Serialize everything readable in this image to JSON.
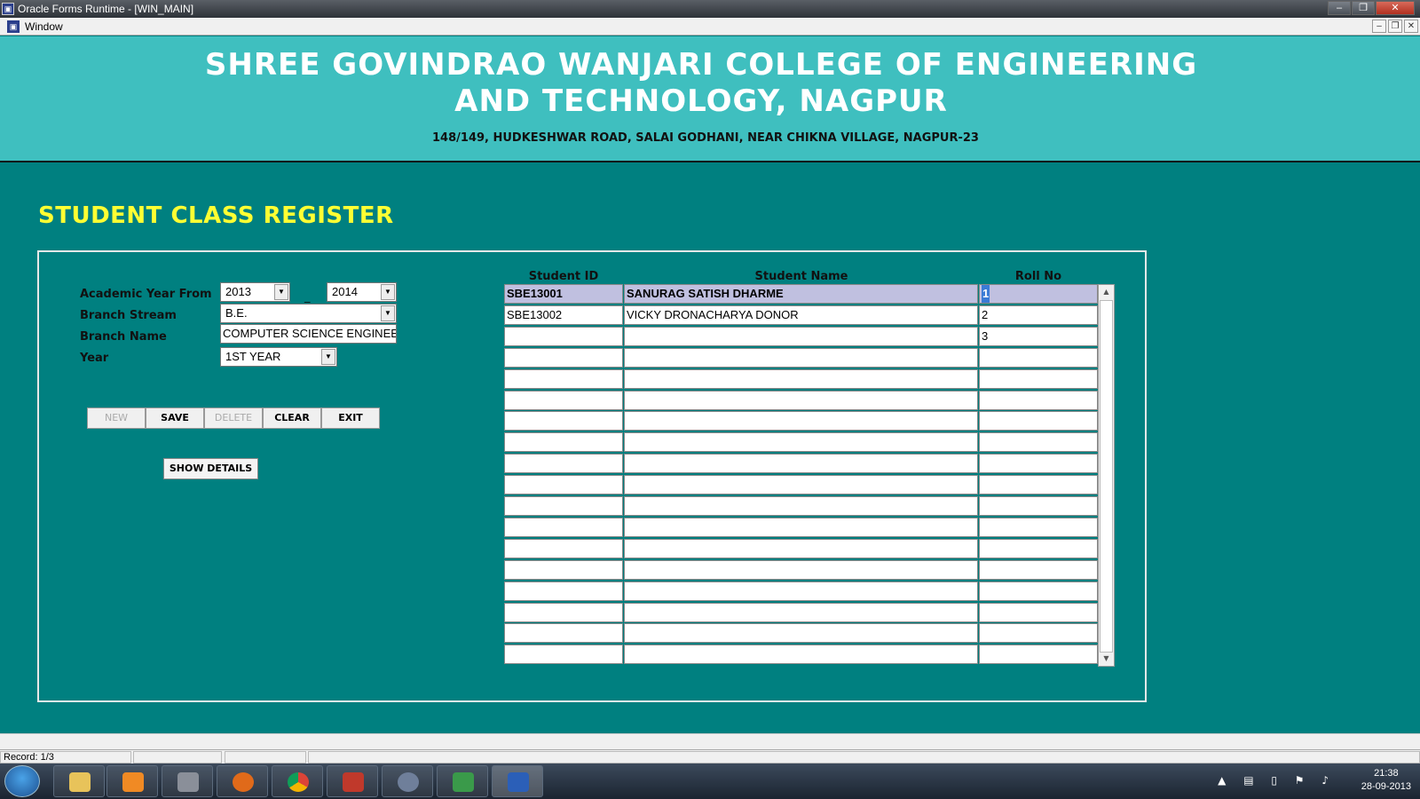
{
  "window": {
    "title": "Oracle Forms Runtime - [WIN_MAIN]",
    "menu_label": "Window"
  },
  "banner": {
    "line1": "SHREE GOVINDRAO WANJARI COLLEGE OF ENGINEERING",
    "line2": "AND TECHNOLOGY, NAGPUR",
    "address": "148/149, HUDKESHWAR ROAD, SALAI GODHANI, NEAR CHIKNA VILLAGE, NAGPUR-23"
  },
  "page_title": "STUDENT CLASS REGISTER",
  "form": {
    "academic_year_label": "Academic Year From",
    "year_from": "2013",
    "year_separator": "_",
    "year_to": "2014",
    "branch_stream_label": "Branch Stream",
    "branch_stream": "B.E.",
    "branch_name_label": "Branch Name",
    "branch_name": "COMPUTER SCIENCE ENGINEE",
    "year_label": "Year",
    "year": "1ST YEAR"
  },
  "buttons": {
    "new": "NEW",
    "save": "SAVE",
    "delete": "DELETE",
    "clear": "CLEAR",
    "exit": "EXIT",
    "show_details": "SHOW DETAILS"
  },
  "grid": {
    "headers": [
      "Student ID",
      "Student Name",
      "Roll No"
    ],
    "rows": [
      [
        "SBE13001",
        "SANURAG SATISH DHARME",
        "1"
      ],
      [
        "SBE13002",
        "VICKY DRONACHARYA DONOR",
        "2"
      ],
      [
        "",
        "",
        "3"
      ],
      [
        "",
        "",
        ""
      ],
      [
        "",
        "",
        ""
      ],
      [
        "",
        "",
        ""
      ],
      [
        "",
        "",
        ""
      ],
      [
        "",
        "",
        ""
      ],
      [
        "",
        "",
        ""
      ],
      [
        "",
        "",
        ""
      ],
      [
        "",
        "",
        ""
      ],
      [
        "",
        "",
        ""
      ],
      [
        "",
        "",
        ""
      ],
      [
        "",
        "",
        ""
      ],
      [
        "",
        "",
        ""
      ],
      [
        "",
        "",
        ""
      ],
      [
        "",
        "",
        ""
      ],
      [
        "",
        "",
        ""
      ]
    ]
  },
  "status": {
    "record": "Record: 1/3"
  },
  "clock": {
    "time": "21:38",
    "date": "28-09-2013"
  }
}
